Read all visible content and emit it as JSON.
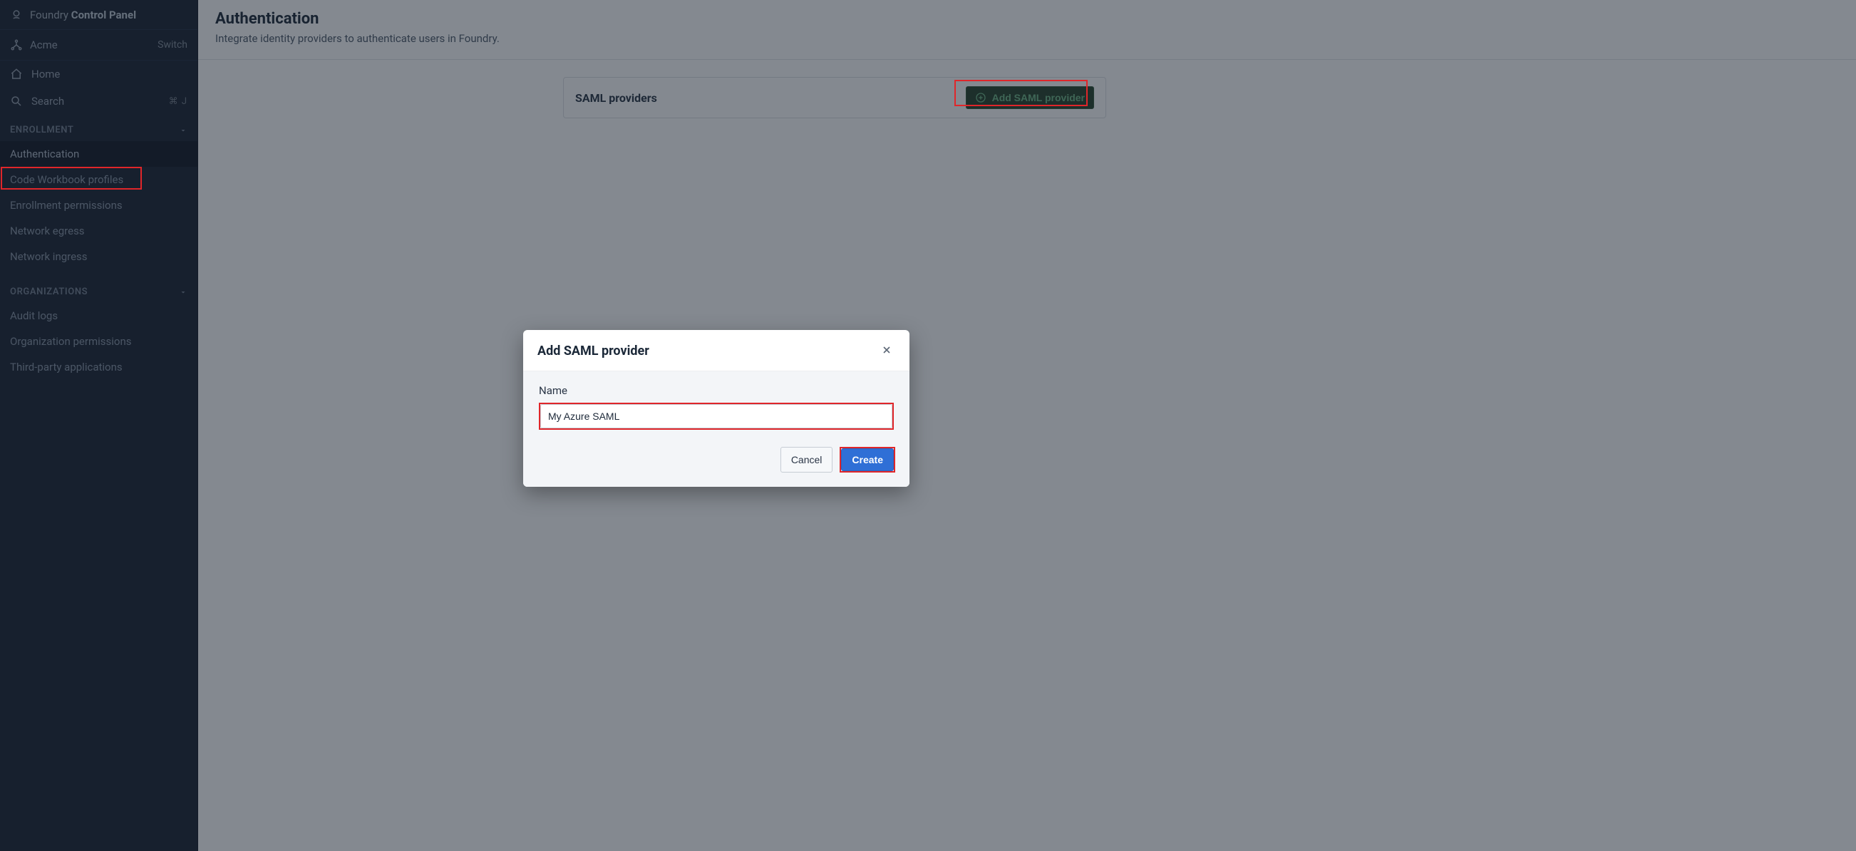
{
  "brand": {
    "prefix": "Foundry ",
    "bold": "Control Panel"
  },
  "org": {
    "name": "Acme",
    "switch_label": "Switch"
  },
  "nav": {
    "home_label": "Home",
    "search_label": "Search",
    "search_kbd": "⌘ J"
  },
  "sections": {
    "enrollment": {
      "header": "ENROLLMENT",
      "items": [
        {
          "label": "Authentication",
          "active": true
        },
        {
          "label": "Code Workbook profiles"
        },
        {
          "label": "Enrollment permissions"
        },
        {
          "label": "Network egress"
        },
        {
          "label": "Network ingress"
        }
      ]
    },
    "organizations": {
      "header": "ORGANIZATIONS",
      "items": [
        {
          "label": "Audit logs"
        },
        {
          "label": "Organization permissions"
        },
        {
          "label": "Third-party applications"
        }
      ]
    }
  },
  "page": {
    "title": "Authentication",
    "subtitle": "Integrate identity providers to authenticate users in Foundry."
  },
  "card": {
    "title": "SAML providers",
    "add_button": "Add SAML provider"
  },
  "modal": {
    "title": "Add SAML provider",
    "name_label": "Name",
    "name_value": "My Azure SAML",
    "cancel": "Cancel",
    "create": "Create"
  }
}
